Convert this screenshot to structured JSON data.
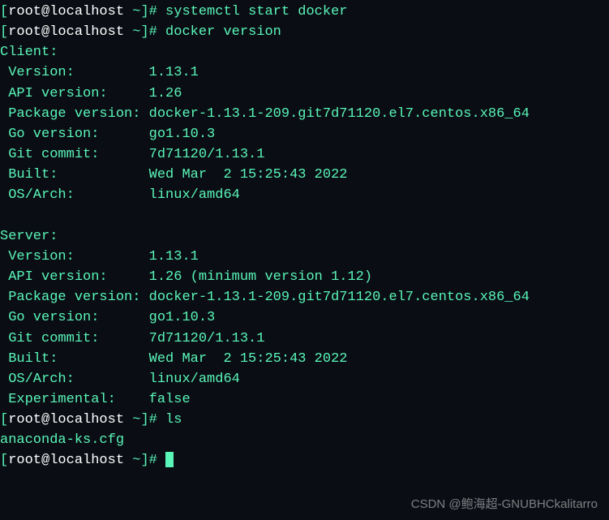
{
  "prompt": {
    "open": "[",
    "user_host": "root@localhost",
    "path": " ~",
    "close": "]# "
  },
  "cmd1": "systemctl start docker",
  "cmd2": "docker version",
  "client_header": "Client:",
  "server_header": "Server:",
  "kv": {
    "version_k": " Version:         ",
    "version_v": "1.13.1",
    "api_k": " API version:     ",
    "api_v_client": "1.26",
    "api_v_server": "1.26 (minimum version 1.12)",
    "pkg_k": " Package version: ",
    "pkg_v": "docker-1.13.1-209.git7d71120.el7.centos.x86_64",
    "go_k": " Go version:      ",
    "go_v": "go1.10.3",
    "git_k": " Git commit:      ",
    "git_v": "7d71120/1.13.1",
    "built_k": " Built:           ",
    "built_v": "Wed Mar  2 15:25:43 2022",
    "os_k": " OS/Arch:         ",
    "os_v": "linux/amd64",
    "exp_k": " Experimental:    ",
    "exp_v": "false"
  },
  "cmd3": "ls",
  "ls_out": "anaconda-ks.cfg",
  "watermark": "CSDN @鲍海超-GNUBHCkalitarro"
}
